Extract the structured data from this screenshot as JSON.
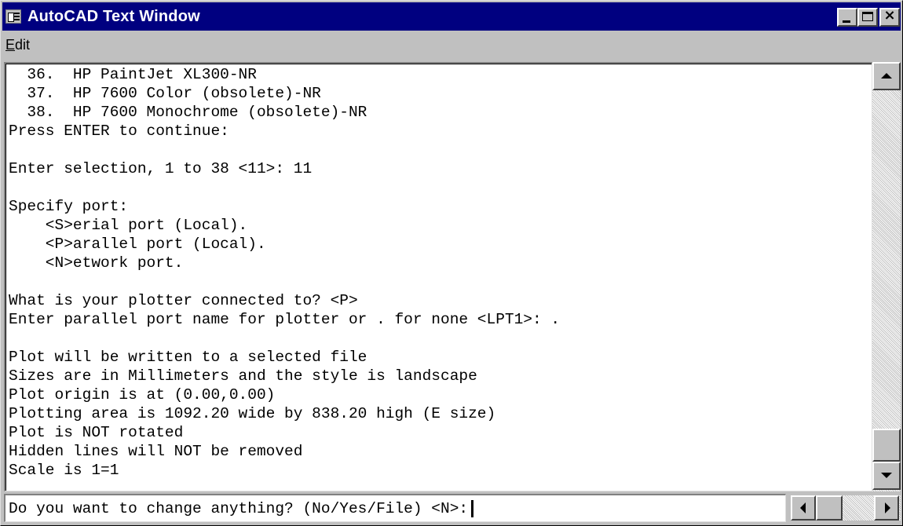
{
  "window": {
    "title": "AutoCAD Text Window",
    "accent_color": "#000080"
  },
  "menu": {
    "items": [
      {
        "label": "Edit",
        "mnemonic": "E",
        "rest": "dit"
      }
    ]
  },
  "text_window": {
    "lines": [
      "  36.  HP PaintJet XL300-NR",
      "  37.  HP 7600 Color (obsolete)-NR",
      "  38.  HP 7600 Monochrome (obsolete)-NR",
      "Press ENTER to continue:",
      "",
      "Enter selection, 1 to 38 <11>: 11",
      "",
      "Specify port:",
      "    <S>erial port (Local).",
      "    <P>arallel port (Local).",
      "    <N>etwork port.",
      "",
      "What is your plotter connected to? <P>",
      "Enter parallel port name for plotter or . for none <LPT1>: .",
      "",
      "Plot will be written to a selected file",
      "Sizes are in Millimeters and the style is landscape",
      "Plot origin is at (0.00,0.00)",
      "Plotting area is 1092.20 wide by 838.20 high (E size)",
      "Plot is NOT rotated",
      "Hidden lines will NOT be removed",
      "Scale is 1=1"
    ]
  },
  "command_line": {
    "prompt": "Do you want to change anything? (No/Yes/File) <N>:"
  },
  "icons": {
    "app": "text-window-icon",
    "minimize": "minimize-icon",
    "maximize": "maximize-icon",
    "close": "close-icon"
  }
}
